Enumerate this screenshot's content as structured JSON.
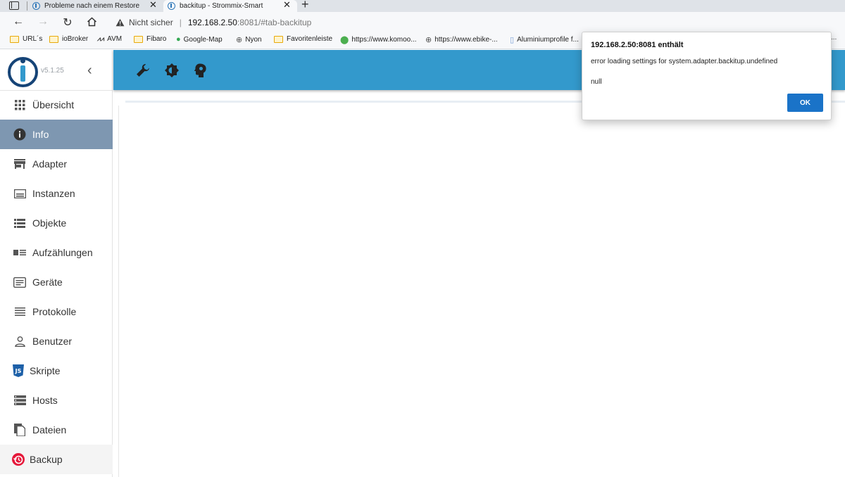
{
  "tabs": [
    {
      "label": "Probleme nach einem Restore",
      "close": "✕"
    },
    {
      "label": "backitup - Strommix-Smart",
      "close": "✕"
    }
  ],
  "new_tab": "+",
  "address": {
    "security_label": "Nicht sicher",
    "separator": "|",
    "host": "192.168.2.50",
    "rest": ":8081/#tab-backitup"
  },
  "bookmarks": [
    "URL´s",
    "ioBroker",
    "AVM",
    "Fibaro",
    "Google-Map",
    "Nyon",
    "Favoritenleiste",
    "https://www.komoo...",
    "https://www.ebike-...",
    "Aluminiumprofile f..."
  ],
  "bookmarks_more": "...",
  "sidebar": {
    "version": "v5.1.25",
    "collapse": "‹",
    "items": [
      {
        "label": "Übersicht"
      },
      {
        "label": "Info"
      },
      {
        "label": "Adapter"
      },
      {
        "label": "Instanzen"
      },
      {
        "label": "Objekte"
      },
      {
        "label": "Aufzählungen"
      },
      {
        "label": "Geräte"
      },
      {
        "label": "Protokolle"
      },
      {
        "label": "Benutzer"
      },
      {
        "label": "Skripte"
      },
      {
        "label": "Hosts"
      },
      {
        "label": "Dateien"
      },
      {
        "label": "Backup"
      }
    ]
  },
  "dialog": {
    "title": "192.168.2.50:8081 enthält",
    "message": "error loading settings for system.adapter.backitup.undefined",
    "detail": "null",
    "ok_label": "OK"
  },
  "colors": {
    "toolbar": "#3399cc",
    "active_nav": "#7e97b1",
    "ok_button": "#1a73c8"
  }
}
